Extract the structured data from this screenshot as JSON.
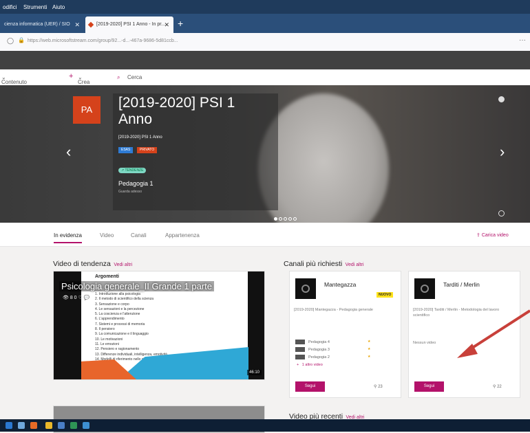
{
  "menu": {
    "items": [
      "odifici",
      "Strumenti",
      "Aiuto"
    ]
  },
  "tabs": [
    {
      "label": "cienza informatica (UER) / SIO"
    },
    {
      "label": "[2019-2020] PSI 1 Anno - In pr..."
    }
  ],
  "url": "https://web.microsoftstream.com/group/92...-d...-467a-9686-5d81ccb...",
  "toolbar": {
    "content": "Contenuto personale",
    "create": "Crea",
    "search": "Cerca"
  },
  "hero": {
    "tile": "PA",
    "title": "[2019-2020] PSI 1 Anno",
    "subtitle": "[2019-2020] PSI 1 Anno",
    "badge1": "ESAS",
    "badge2": "PRIVATO",
    "trending": "TENDENZE",
    "video_title": "Pedagogia 1",
    "video_sub": "Guarda adesso"
  },
  "nav": {
    "tabs": [
      "In evidenza",
      "Video",
      "Canali",
      "Appartenenza"
    ],
    "upload": "Carica video"
  },
  "trending": {
    "title": "Video di tendenza",
    "see_all": "Vedi altri",
    "video": {
      "title": "Psicologia generale_II Grande 1 parte",
      "counts": "8 0",
      "duration": "46:10",
      "slide_heading": "Argomenti",
      "slide_lines": [
        "1. Introduzione alla psicologia",
        "2. Il metodo di scientifico della scienza",
        "3. Sensazione e corpo",
        "4. Le sensazioni e la percezione",
        "5. La coscienza e l'attenzione",
        "6. L'apprendimento",
        "7. Sistemi e processi di memoria",
        "8. Il pensiero",
        "9. La comunicazione e il linguaggio",
        "10. Le motivazioni",
        "11. Le emozioni",
        "12. Pensiero e ragionamento",
        "13. Differenze individuali, intelligenza, emotività",
        "14. Modelli di riferimento nello studio della personalità"
      ]
    }
  },
  "channels": {
    "title": "Canali più richiesti",
    "see_all": "Vedi altri",
    "cards": [
      {
        "name": "Mantegazza",
        "badge": "NUOVO",
        "desc": "[2019-2020] Mantegazza - Pedagogia generale",
        "videos": [
          "Pedagogia 4",
          "Pedagogia 3",
          "Pedagogia 2"
        ],
        "more": "1 altro video",
        "follow": "Segui",
        "followers": "23"
      },
      {
        "name": "Tarditi / Merlin",
        "desc": "[2019-2020] Tarditi / Merlin - Metodologia del lavoro scientifico",
        "videos_empty": "Nessun video",
        "follow": "Segui",
        "followers": "22"
      }
    ]
  },
  "recent": {
    "title": "Video più recenti",
    "see_all": "Vedi altri"
  },
  "colors": {
    "accent": "#b3126a",
    "tile": "#d5421b",
    "arrow": "#c8403a"
  }
}
